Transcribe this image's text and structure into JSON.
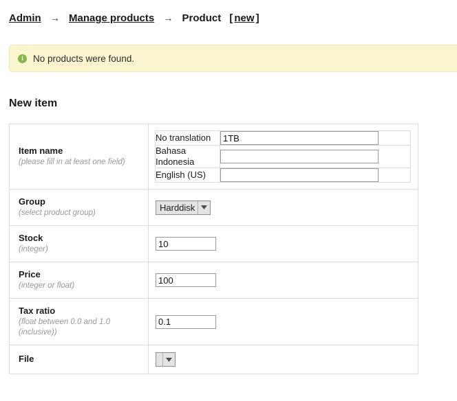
{
  "breadcrumb": {
    "admin": "Admin",
    "separator": "→",
    "manage_products": "Manage products",
    "current": "Product",
    "bracket_open": "[",
    "action": "new",
    "bracket_close": "]"
  },
  "alert": {
    "icon": "info-icon",
    "message": "No products were found.",
    "background_color": "#fbf5cf",
    "border_color": "#f3e9b0",
    "icon_color": "#84b84c",
    "icon_glyph": "i"
  },
  "page": {
    "heading": "New item"
  },
  "form": {
    "rows": [
      {
        "label": "Item name",
        "hint": "(please fill in at least one field)",
        "type": "translations",
        "translations": [
          {
            "language": "No translation",
            "value": "1TB",
            "placeholder": ""
          },
          {
            "language": "Bahasa Indonesia",
            "value": "",
            "placeholder": ""
          },
          {
            "language": "English (US)",
            "value": "",
            "placeholder": ""
          }
        ]
      },
      {
        "label": "Group",
        "hint": "(select product group)",
        "type": "select",
        "selected": "Harddisk"
      },
      {
        "label": "Stock",
        "hint": "(integer)",
        "type": "text",
        "value": "10",
        "placeholder": ""
      },
      {
        "label": "Price",
        "hint": "(integer or float)",
        "type": "text",
        "value": "100",
        "placeholder": ""
      },
      {
        "label": "Tax ratio",
        "hint": "(float between 0.0 and 1.0 (inclusive))",
        "type": "text",
        "value": "0.1",
        "placeholder": ""
      },
      {
        "label": "File",
        "hint": "",
        "type": "select",
        "selected": ""
      }
    ]
  }
}
